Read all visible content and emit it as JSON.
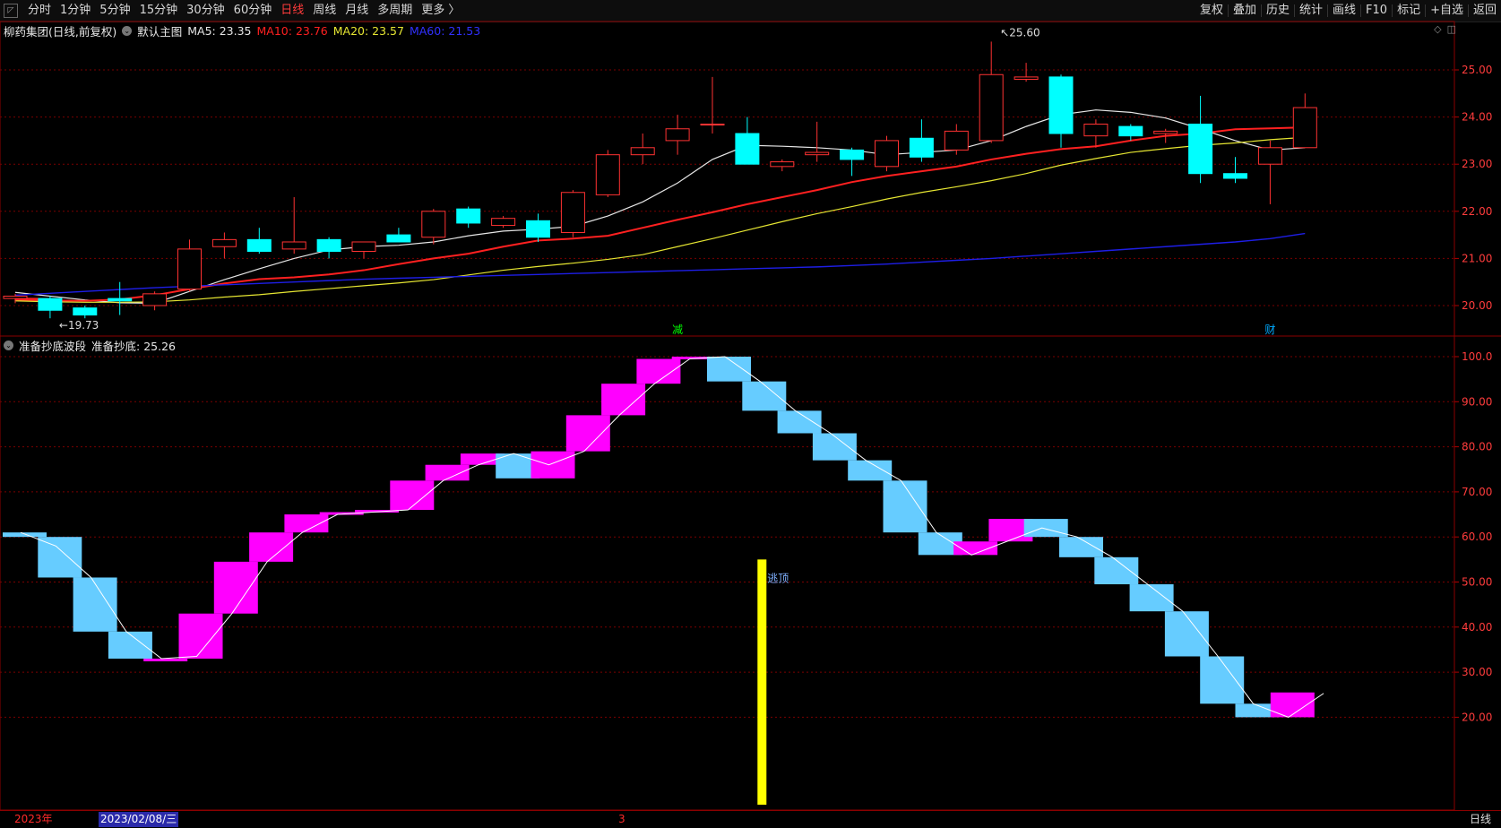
{
  "toolbar": {
    "left_items": [
      "分时",
      "1分钟",
      "5分钟",
      "15分钟",
      "30分钟",
      "60分钟",
      "日线",
      "周线",
      "月线",
      "多周期",
      "更多 〉"
    ],
    "active_item": "日线",
    "right_items": [
      "复权",
      "叠加",
      "历史",
      "统计",
      "画线",
      "F10",
      "标记",
      "+自选",
      "返回"
    ]
  },
  "main_header": {
    "stock": "柳药集团(日线,前复权)",
    "chart_name": "默认主图",
    "ma5": "MA5: 23.35",
    "ma10": "MA10: 23.76",
    "ma20": "MA20: 23.57",
    "ma60": "MA60: 21.53"
  },
  "sub_header": {
    "name": "准备抄底波段",
    "value": "准备抄底: 25.26"
  },
  "bottom": {
    "year": "2023年",
    "date": "2023/02/08/三",
    "month_mark": "3",
    "period": "日线"
  },
  "colors": {
    "up": "#ff3232",
    "down": "#00ffff",
    "ma5": "#e6e6e6",
    "ma10": "#ff2020",
    "ma20": "#e6e632",
    "ma60": "#1e1ee6",
    "bar_up": "#ff00ff",
    "bar_down": "#66ccff",
    "signal": "#ffff00"
  },
  "chart_data": [
    {
      "type": "candlestick",
      "ylim": [
        19.6,
        25.6
      ],
      "yticks": [
        "25.00",
        "24.00",
        "23.00",
        "22.00",
        "21.00",
        "20.00"
      ],
      "ohlc": [
        [
          20.15,
          20.25,
          20.05,
          20.2
        ],
        [
          20.15,
          20.2,
          19.73,
          19.9
        ],
        [
          19.95,
          20.0,
          19.73,
          19.8
        ],
        [
          20.15,
          20.5,
          19.8,
          20.1
        ],
        [
          20.0,
          20.3,
          19.9,
          20.25
        ],
        [
          20.35,
          21.4,
          20.3,
          21.2
        ],
        [
          21.25,
          21.55,
          21.0,
          21.4
        ],
        [
          21.4,
          21.65,
          21.1,
          21.15
        ],
        [
          21.2,
          22.3,
          21.1,
          21.35
        ],
        [
          21.4,
          21.45,
          21.0,
          21.15
        ],
        [
          21.15,
          21.35,
          21.0,
          21.35
        ],
        [
          21.5,
          21.65,
          21.4,
          21.35
        ],
        [
          21.45,
          22.05,
          21.3,
          22.0
        ],
        [
          22.05,
          22.1,
          21.65,
          21.75
        ],
        [
          21.7,
          21.9,
          21.65,
          21.85
        ],
        [
          21.8,
          21.95,
          21.35,
          21.45
        ],
        [
          21.55,
          22.45,
          21.45,
          22.4
        ],
        [
          22.35,
          23.3,
          22.3,
          23.2
        ],
        [
          23.2,
          23.65,
          23.0,
          23.35
        ],
        [
          23.5,
          24.05,
          23.2,
          23.75
        ],
        [
          23.85,
          24.85,
          23.65,
          23.85
        ],
        [
          23.65,
          24.0,
          23.0,
          23.0
        ],
        [
          22.95,
          23.1,
          22.85,
          23.05
        ],
        [
          23.2,
          23.9,
          23.05,
          23.25
        ],
        [
          23.3,
          23.35,
          22.75,
          23.1
        ],
        [
          22.95,
          23.6,
          22.85,
          23.5
        ],
        [
          23.55,
          23.95,
          23.05,
          23.15
        ],
        [
          23.3,
          23.85,
          23.2,
          23.7
        ],
        [
          23.5,
          25.6,
          23.45,
          24.9
        ],
        [
          24.8,
          25.15,
          24.75,
          24.85
        ],
        [
          24.85,
          24.9,
          23.35,
          23.65
        ],
        [
          23.6,
          23.95,
          23.35,
          23.85
        ],
        [
          23.8,
          23.85,
          23.5,
          23.6
        ],
        [
          23.65,
          23.75,
          23.45,
          23.7
        ],
        [
          23.85,
          24.45,
          22.6,
          22.8
        ],
        [
          22.8,
          23.15,
          22.6,
          22.7
        ],
        [
          23.0,
          23.5,
          22.15,
          23.35
        ],
        [
          23.35,
          24.5,
          23.35,
          24.2
        ]
      ],
      "series": [
        {
          "name": "MA5",
          "values": [
            20.28,
            20.2,
            20.12,
            20.06,
            20.05,
            20.3,
            20.55,
            20.78,
            21.0,
            21.18,
            21.25,
            21.28,
            21.35,
            21.48,
            21.58,
            21.62,
            21.68,
            21.9,
            22.2,
            22.6,
            23.1,
            23.4,
            23.38,
            23.35,
            23.3,
            23.2,
            23.25,
            23.3,
            23.5,
            23.8,
            24.05,
            24.15,
            24.1,
            23.98,
            23.75,
            23.5,
            23.3,
            23.35
          ]
        },
        {
          "name": "MA10",
          "values": [
            20.15,
            20.14,
            20.12,
            20.11,
            20.1,
            20.13,
            20.22,
            20.35,
            20.47,
            20.56,
            20.6,
            20.66,
            20.75,
            20.88,
            21.0,
            21.1,
            21.25,
            21.38,
            21.42,
            21.48,
            21.65,
            21.82,
            21.98,
            22.15,
            22.3,
            22.45,
            22.62,
            22.75,
            22.85,
            22.95,
            23.1,
            23.22,
            23.32,
            23.38,
            23.5,
            23.6,
            23.65,
            23.74,
            23.76,
            23.78
          ]
        },
        {
          "name": "MA20",
          "values": [
            20.12,
            20.1,
            20.08,
            20.07,
            20.07,
            20.08,
            20.12,
            20.18,
            20.23,
            20.3,
            20.36,
            20.42,
            20.48,
            20.55,
            20.65,
            20.75,
            20.83,
            20.9,
            20.98,
            21.08,
            21.25,
            21.42,
            21.6,
            21.78,
            21.95,
            22.1,
            22.26,
            22.4,
            22.52,
            22.65,
            22.8,
            22.98,
            23.12,
            23.25,
            23.33,
            23.4,
            23.45,
            23.52,
            23.57
          ]
        },
        {
          "name": "MA60",
          "values": [
            20.22,
            20.26,
            20.3,
            20.34,
            20.38,
            20.41,
            20.44,
            20.47,
            20.5,
            20.53,
            20.56,
            20.58,
            20.6,
            20.62,
            20.64,
            20.66,
            20.68,
            20.7,
            20.72,
            20.74,
            20.76,
            20.78,
            20.8,
            20.82,
            20.85,
            20.88,
            20.92,
            20.96,
            21.0,
            21.05,
            21.1,
            21.15,
            21.2,
            21.25,
            21.3,
            21.35,
            21.42,
            21.53
          ]
        }
      ],
      "annotations": [
        {
          "text": "19.73",
          "index": 1,
          "value": 19.73
        },
        {
          "text": "25.60",
          "index": 28,
          "value": 25.6
        },
        {
          "text": "减",
          "index": 19,
          "color": "#00ff00"
        },
        {
          "text": "财",
          "index": 36,
          "color": "#00aaff"
        }
      ]
    },
    {
      "type": "bar",
      "title": "准备抄底波段",
      "ylim": [
        0,
        105
      ],
      "yticks": [
        "100.0",
        "90.00",
        "80.00",
        "70.00",
        "60.00",
        "50.00",
        "40.00",
        "30.00",
        "20.00"
      ],
      "boxes": [
        [
          61,
          60,
          "down"
        ],
        [
          60,
          51,
          "down"
        ],
        [
          51,
          39,
          "down"
        ],
        [
          39,
          33,
          "down"
        ],
        [
          33,
          33,
          "up"
        ],
        [
          33,
          43,
          "up"
        ],
        [
          43,
          54.5,
          "up"
        ],
        [
          54.5,
          61,
          "up"
        ],
        [
          61,
          65,
          "up"
        ],
        [
          65,
          65.5,
          "up"
        ],
        [
          65.5,
          66,
          "up"
        ],
        [
          66,
          72.5,
          "up"
        ],
        [
          72.5,
          76,
          "up"
        ],
        [
          76,
          78.5,
          "up"
        ],
        [
          78.5,
          73,
          "down"
        ],
        [
          73,
          79,
          "up"
        ],
        [
          79,
          87,
          "up"
        ],
        [
          87,
          94,
          "up"
        ],
        [
          94,
          99.5,
          "up"
        ],
        [
          99.5,
          100,
          "up"
        ],
        [
          100,
          94.5,
          "down"
        ],
        [
          94.5,
          88,
          "down"
        ],
        [
          88,
          83,
          "down"
        ],
        [
          83,
          77,
          "down"
        ],
        [
          77,
          72.5,
          "down"
        ],
        [
          72.5,
          61,
          "down"
        ],
        [
          61,
          56,
          "down"
        ],
        [
          56,
          59,
          "up"
        ],
        [
          59,
          64,
          "up"
        ],
        [
          64,
          60,
          "down"
        ],
        [
          60,
          55.5,
          "down"
        ],
        [
          55.5,
          49.5,
          "down"
        ],
        [
          49.5,
          43.5,
          "down"
        ],
        [
          43.5,
          33.5,
          "down"
        ],
        [
          33.5,
          23,
          "down"
        ],
        [
          23,
          20,
          "down"
        ],
        [
          20,
          25.5,
          "up"
        ]
      ],
      "line": [
        61,
        58,
        51,
        39,
        33,
        33.5,
        43,
        54.5,
        61,
        65,
        65.5,
        66,
        72.5,
        76,
        78.5,
        76,
        79,
        87,
        94,
        99.5,
        100,
        94.5,
        88,
        83,
        77,
        72.5,
        61,
        56,
        59,
        62,
        60,
        55.5,
        49.5,
        43.5,
        33.5,
        23,
        20,
        25.3
      ],
      "signal": {
        "text": "逃顶",
        "index": 21,
        "from": 0,
        "to": 55
      }
    }
  ]
}
